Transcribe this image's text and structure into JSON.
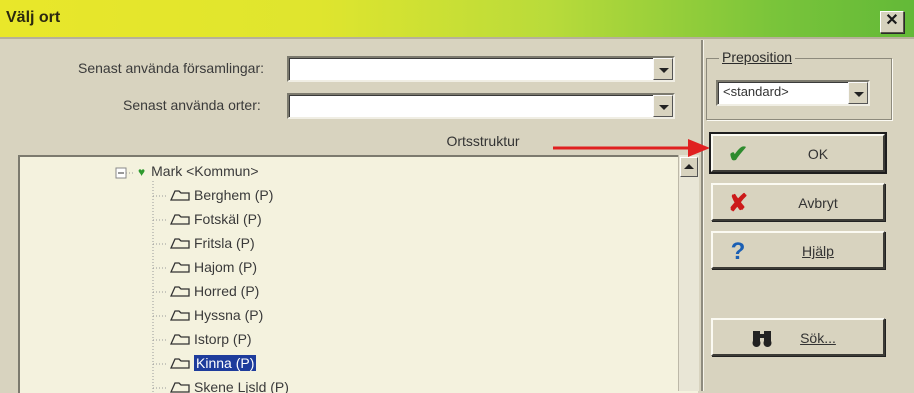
{
  "window": {
    "title": "Välj ort",
    "close_glyph": "✕"
  },
  "fields": {
    "recent_parishes": {
      "label": "Senast använda församlingar:",
      "value": ""
    },
    "recent_places": {
      "label": "Senast använda orter:",
      "value": ""
    }
  },
  "preposition": {
    "legend": "Preposition",
    "value": "<standard>"
  },
  "tree": {
    "header": "Ortsstruktur",
    "root": "Mark <Kommun>",
    "items": [
      "Berghem (P)",
      "Fotskäl (P)",
      "Fritsla (P)",
      "Hajom (P)",
      "Horred (P)",
      "Hyssna (P)",
      "Istorp (P)",
      "Kinna (P)",
      "Skene Ljsld (P)"
    ],
    "selected_index": 7
  },
  "buttons": {
    "ok": {
      "label": "OK",
      "icon": "checkmark-icon",
      "color": "#2e8b2e"
    },
    "cancel": {
      "label": "Avbryt",
      "icon": "x-icon",
      "color": "#cc1a1a"
    },
    "help": {
      "label": "Hjälp",
      "icon": "question-icon",
      "color": "#1a5fb4"
    },
    "search": {
      "label": "Sök...",
      "icon": "binoculars-icon"
    }
  },
  "colors": {
    "dialog_bg": "#d8d3bf",
    "tree_bg": "#f4f2de",
    "arrow": "#e02020",
    "selection": "#1e3c9c"
  }
}
